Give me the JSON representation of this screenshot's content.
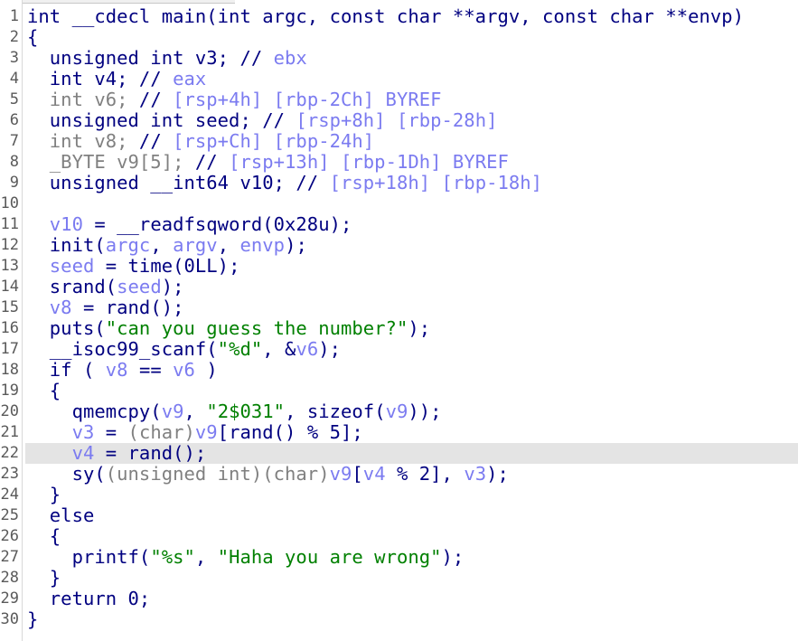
{
  "colors": {
    "default": "#000080",
    "variable": "#7b7bf0",
    "gray": "#808080",
    "string": "#008000",
    "highlight": "#e4e4e4"
  },
  "highlighted_line": 22,
  "lines": [
    [
      [
        "n",
        "int __cdecl main(int argc, const char **argv, const char **envp)"
      ]
    ],
    [
      [
        "n",
        "{"
      ]
    ],
    [
      [
        "n",
        "  unsigned int v3; // "
      ],
      [
        "c",
        "ebx"
      ]
    ],
    [
      [
        "n",
        "  int v4; // "
      ],
      [
        "c",
        "eax"
      ]
    ],
    [
      [
        "g",
        "  int v6; "
      ],
      [
        "n",
        "// "
      ],
      [
        "c",
        "[rsp+4h] [rbp-2Ch] BYREF"
      ]
    ],
    [
      [
        "n",
        "  unsigned int seed; // "
      ],
      [
        "c",
        "[rsp+8h] [rbp-28h]"
      ]
    ],
    [
      [
        "g",
        "  int v8; "
      ],
      [
        "n",
        "// "
      ],
      [
        "c",
        "[rsp+Ch] [rbp-24h]"
      ]
    ],
    [
      [
        "g",
        "  _BYTE v9[5]; "
      ],
      [
        "n",
        "// "
      ],
      [
        "c",
        "[rsp+13h] [rbp-1Dh] BYREF"
      ]
    ],
    [
      [
        "n",
        "  unsigned __int64 v10; // "
      ],
      [
        "c",
        "[rsp+18h] [rbp-18h]"
      ]
    ],
    [
      [
        "n",
        ""
      ]
    ],
    [
      [
        "v",
        "  v10"
      ],
      [
        "n",
        " = __readfsqword(0x28u);"
      ]
    ],
    [
      [
        "n",
        "  init("
      ],
      [
        "v",
        "argc"
      ],
      [
        "n",
        ", "
      ],
      [
        "v",
        "argv"
      ],
      [
        "n",
        ", "
      ],
      [
        "v",
        "envp"
      ],
      [
        "n",
        ");"
      ]
    ],
    [
      [
        "v",
        "  seed"
      ],
      [
        "n",
        " = time(0LL);"
      ]
    ],
    [
      [
        "n",
        "  srand("
      ],
      [
        "v",
        "seed"
      ],
      [
        "n",
        ");"
      ]
    ],
    [
      [
        "v",
        "  v8"
      ],
      [
        "n",
        " = rand();"
      ]
    ],
    [
      [
        "n",
        "  puts("
      ],
      [
        "s",
        "\"can you guess the number?\""
      ],
      [
        "n",
        ");"
      ]
    ],
    [
      [
        "n",
        "  __isoc99_scanf("
      ],
      [
        "s",
        "\"%d\""
      ],
      [
        "n",
        ", &"
      ],
      [
        "v",
        "v6"
      ],
      [
        "n",
        ");"
      ]
    ],
    [
      [
        "n",
        "  if ( "
      ],
      [
        "v",
        "v8"
      ],
      [
        "n",
        " == "
      ],
      [
        "v",
        "v6"
      ],
      [
        "n",
        " )"
      ]
    ],
    [
      [
        "n",
        "  {"
      ]
    ],
    [
      [
        "n",
        "    qmemcpy("
      ],
      [
        "v",
        "v9"
      ],
      [
        "n",
        ", "
      ],
      [
        "s",
        "\"2$031\""
      ],
      [
        "n",
        ", sizeof("
      ],
      [
        "v",
        "v9"
      ],
      [
        "n",
        "));"
      ]
    ],
    [
      [
        "v",
        "    v3"
      ],
      [
        "n",
        " = "
      ],
      [
        "g",
        "(char)"
      ],
      [
        "v",
        "v9"
      ],
      [
        "n",
        "[rand() % 5];"
      ]
    ],
    [
      [
        "v",
        "    v4"
      ],
      [
        "n",
        " = rand();"
      ]
    ],
    [
      [
        "n",
        "    sy("
      ],
      [
        "g",
        "(unsigned int)(char)"
      ],
      [
        "v",
        "v9"
      ],
      [
        "n",
        "["
      ],
      [
        "v",
        "v4"
      ],
      [
        "n",
        " % 2], "
      ],
      [
        "v",
        "v3"
      ],
      [
        "n",
        ");"
      ]
    ],
    [
      [
        "n",
        "  }"
      ]
    ],
    [
      [
        "n",
        "  else"
      ]
    ],
    [
      [
        "n",
        "  {"
      ]
    ],
    [
      [
        "n",
        "    printf("
      ],
      [
        "s",
        "\"%s\""
      ],
      [
        "n",
        ", "
      ],
      [
        "s",
        "\"Haha you are wrong\""
      ],
      [
        "n",
        ");"
      ]
    ],
    [
      [
        "n",
        "  }"
      ]
    ],
    [
      [
        "n",
        "  return 0;"
      ]
    ],
    [
      [
        "n",
        "}"
      ]
    ]
  ]
}
